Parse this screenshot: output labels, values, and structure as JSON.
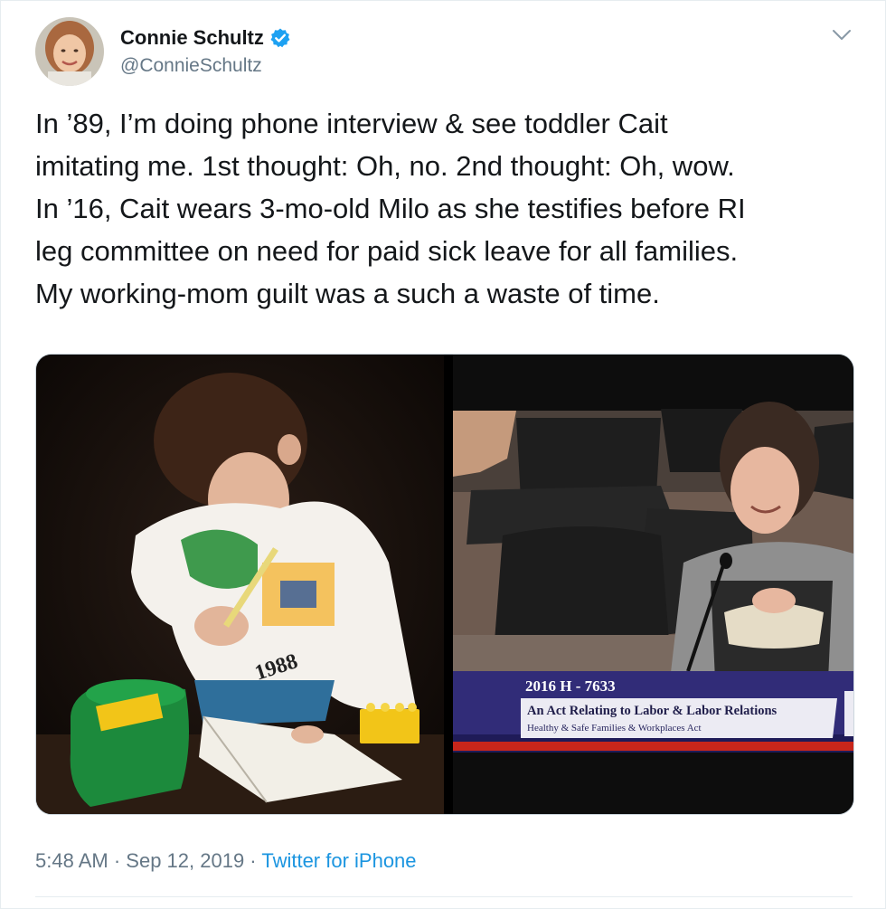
{
  "author": {
    "name": "Connie Schultz",
    "handle": "@ConnieSchultz",
    "verified_icon": "verified-badge-icon"
  },
  "tweet": {
    "lines": [
      "In ’89, I’m doing phone interview & see toddler Cait",
      "imitating me. 1st thought: Oh, no. 2nd thought: Oh, wow.",
      "In ’16, Cait wears 3-mo-old Milo as she testifies before RI",
      "leg committee on need for paid sick leave for all families.",
      "My working-mom guilt was a such a waste of time."
    ]
  },
  "media": {
    "left_photo": {
      "shirt_text": "1988"
    },
    "right_photo": {
      "caption_bill": "2016 H - 7633",
      "caption_title": "An Act Relating to Labor & Labor Relations",
      "caption_subtitle": "Healthy & Safe Families & Workplaces Act"
    }
  },
  "meta": {
    "time": "5:48 AM",
    "separator": " · ",
    "date": "Sep 12, 2019",
    "source": "Twitter for iPhone"
  },
  "colors": {
    "link": "#1b95e0",
    "secondary_text": "#657786",
    "verified": "#1da1f2"
  }
}
